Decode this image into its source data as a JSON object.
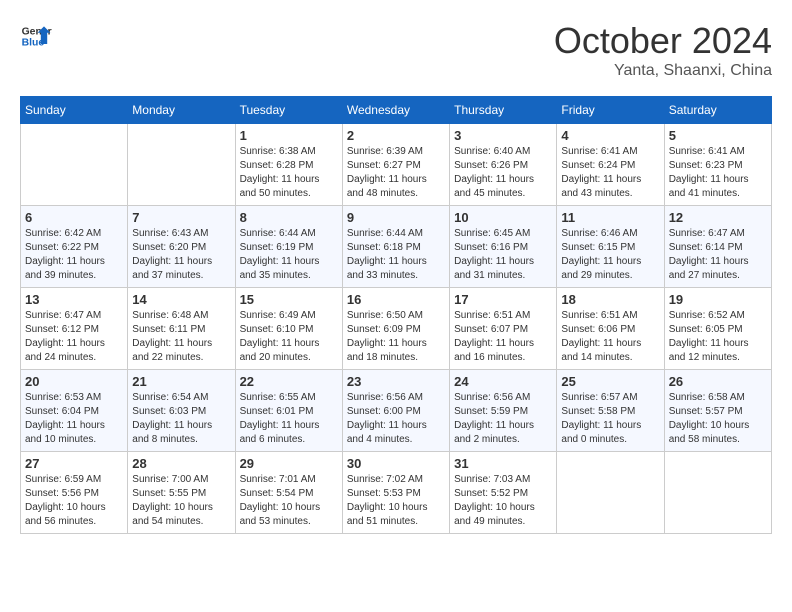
{
  "header": {
    "logo_line1": "General",
    "logo_line2": "Blue",
    "month_title": "October 2024",
    "subtitle": "Yanta, Shaanxi, China"
  },
  "days_of_week": [
    "Sunday",
    "Monday",
    "Tuesday",
    "Wednesday",
    "Thursday",
    "Friday",
    "Saturday"
  ],
  "weeks": [
    [
      {
        "day": "",
        "info": ""
      },
      {
        "day": "",
        "info": ""
      },
      {
        "day": "1",
        "info": "Sunrise: 6:38 AM\nSunset: 6:28 PM\nDaylight: 11 hours and 50 minutes."
      },
      {
        "day": "2",
        "info": "Sunrise: 6:39 AM\nSunset: 6:27 PM\nDaylight: 11 hours and 48 minutes."
      },
      {
        "day": "3",
        "info": "Sunrise: 6:40 AM\nSunset: 6:26 PM\nDaylight: 11 hours and 45 minutes."
      },
      {
        "day": "4",
        "info": "Sunrise: 6:41 AM\nSunset: 6:24 PM\nDaylight: 11 hours and 43 minutes."
      },
      {
        "day": "5",
        "info": "Sunrise: 6:41 AM\nSunset: 6:23 PM\nDaylight: 11 hours and 41 minutes."
      }
    ],
    [
      {
        "day": "6",
        "info": "Sunrise: 6:42 AM\nSunset: 6:22 PM\nDaylight: 11 hours and 39 minutes."
      },
      {
        "day": "7",
        "info": "Sunrise: 6:43 AM\nSunset: 6:20 PM\nDaylight: 11 hours and 37 minutes."
      },
      {
        "day": "8",
        "info": "Sunrise: 6:44 AM\nSunset: 6:19 PM\nDaylight: 11 hours and 35 minutes."
      },
      {
        "day": "9",
        "info": "Sunrise: 6:44 AM\nSunset: 6:18 PM\nDaylight: 11 hours and 33 minutes."
      },
      {
        "day": "10",
        "info": "Sunrise: 6:45 AM\nSunset: 6:16 PM\nDaylight: 11 hours and 31 minutes."
      },
      {
        "day": "11",
        "info": "Sunrise: 6:46 AM\nSunset: 6:15 PM\nDaylight: 11 hours and 29 minutes."
      },
      {
        "day": "12",
        "info": "Sunrise: 6:47 AM\nSunset: 6:14 PM\nDaylight: 11 hours and 27 minutes."
      }
    ],
    [
      {
        "day": "13",
        "info": "Sunrise: 6:47 AM\nSunset: 6:12 PM\nDaylight: 11 hours and 24 minutes."
      },
      {
        "day": "14",
        "info": "Sunrise: 6:48 AM\nSunset: 6:11 PM\nDaylight: 11 hours and 22 minutes."
      },
      {
        "day": "15",
        "info": "Sunrise: 6:49 AM\nSunset: 6:10 PM\nDaylight: 11 hours and 20 minutes."
      },
      {
        "day": "16",
        "info": "Sunrise: 6:50 AM\nSunset: 6:09 PM\nDaylight: 11 hours and 18 minutes."
      },
      {
        "day": "17",
        "info": "Sunrise: 6:51 AM\nSunset: 6:07 PM\nDaylight: 11 hours and 16 minutes."
      },
      {
        "day": "18",
        "info": "Sunrise: 6:51 AM\nSunset: 6:06 PM\nDaylight: 11 hours and 14 minutes."
      },
      {
        "day": "19",
        "info": "Sunrise: 6:52 AM\nSunset: 6:05 PM\nDaylight: 11 hours and 12 minutes."
      }
    ],
    [
      {
        "day": "20",
        "info": "Sunrise: 6:53 AM\nSunset: 6:04 PM\nDaylight: 11 hours and 10 minutes."
      },
      {
        "day": "21",
        "info": "Sunrise: 6:54 AM\nSunset: 6:03 PM\nDaylight: 11 hours and 8 minutes."
      },
      {
        "day": "22",
        "info": "Sunrise: 6:55 AM\nSunset: 6:01 PM\nDaylight: 11 hours and 6 minutes."
      },
      {
        "day": "23",
        "info": "Sunrise: 6:56 AM\nSunset: 6:00 PM\nDaylight: 11 hours and 4 minutes."
      },
      {
        "day": "24",
        "info": "Sunrise: 6:56 AM\nSunset: 5:59 PM\nDaylight: 11 hours and 2 minutes."
      },
      {
        "day": "25",
        "info": "Sunrise: 6:57 AM\nSunset: 5:58 PM\nDaylight: 11 hours and 0 minutes."
      },
      {
        "day": "26",
        "info": "Sunrise: 6:58 AM\nSunset: 5:57 PM\nDaylight: 10 hours and 58 minutes."
      }
    ],
    [
      {
        "day": "27",
        "info": "Sunrise: 6:59 AM\nSunset: 5:56 PM\nDaylight: 10 hours and 56 minutes."
      },
      {
        "day": "28",
        "info": "Sunrise: 7:00 AM\nSunset: 5:55 PM\nDaylight: 10 hours and 54 minutes."
      },
      {
        "day": "29",
        "info": "Sunrise: 7:01 AM\nSunset: 5:54 PM\nDaylight: 10 hours and 53 minutes."
      },
      {
        "day": "30",
        "info": "Sunrise: 7:02 AM\nSunset: 5:53 PM\nDaylight: 10 hours and 51 minutes."
      },
      {
        "day": "31",
        "info": "Sunrise: 7:03 AM\nSunset: 5:52 PM\nDaylight: 10 hours and 49 minutes."
      },
      {
        "day": "",
        "info": ""
      },
      {
        "day": "",
        "info": ""
      }
    ]
  ]
}
